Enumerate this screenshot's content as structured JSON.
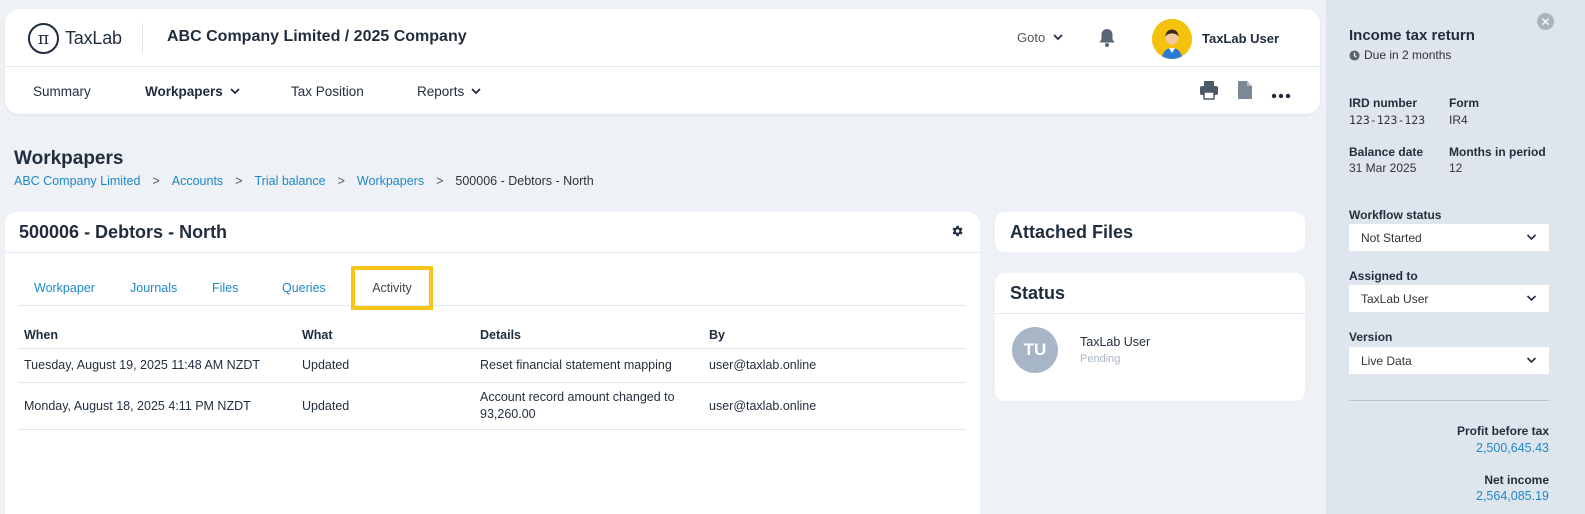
{
  "header": {
    "logo_text": "TaxLab",
    "company": "ABC Company Limited / 2025 Company",
    "goto_label": "Goto",
    "user_name": "TaxLab User"
  },
  "nav": {
    "items": [
      {
        "label": "Summary"
      },
      {
        "label": "Workpapers"
      },
      {
        "label": "Tax Position"
      },
      {
        "label": "Reports"
      }
    ]
  },
  "page": {
    "title": "Workpapers",
    "breadcrumb": [
      "ABC Company Limited",
      "Accounts",
      "Trial balance",
      "Workpapers",
      "500006 - Debtors - North"
    ]
  },
  "workpaper": {
    "title": "500006 - Debtors - North",
    "tabs": [
      "Workpaper",
      "Journals",
      "Files",
      "Queries",
      "Activity"
    ],
    "active_tab": "Activity",
    "columns": [
      "When",
      "What",
      "Details",
      "By"
    ],
    "rows": [
      {
        "when": "Tuesday, August 19, 2025 11:48 AM NZDT",
        "what": "Updated",
        "details": "Reset financial statement mapping",
        "by": "user@taxlab.online"
      },
      {
        "when": "Monday, August 18, 2025 4:11 PM NZDT",
        "what": "Updated",
        "details": "Account record amount changed to 93,260.00",
        "by": "user@taxlab.online"
      }
    ]
  },
  "attached": {
    "title": "Attached Files"
  },
  "status": {
    "title": "Status",
    "initials": "TU",
    "name": "TaxLab User",
    "state": "Pending"
  },
  "panel": {
    "title": "Income tax return",
    "due": "Due in 2 months",
    "ird_label": "IRD number",
    "ird_value": "123-123-123",
    "form_label": "Form",
    "form_value": "IR4",
    "balance_label": "Balance date",
    "balance_value": "31 Mar 2025",
    "months_label": "Months in period",
    "months_value": "12",
    "workflow_label": "Workflow status",
    "workflow_value": "Not Started",
    "assigned_label": "Assigned to",
    "assigned_value": "TaxLab User",
    "version_label": "Version",
    "version_value": "Live Data",
    "profit_label": "Profit before tax",
    "profit_value": "2,500,645.43",
    "net_label": "Net income",
    "net_value": "2,564,085.19"
  },
  "colors": {
    "accent": "#1e88c9",
    "highlight": "#f5c518",
    "panel_bg": "#dfe5ec"
  }
}
